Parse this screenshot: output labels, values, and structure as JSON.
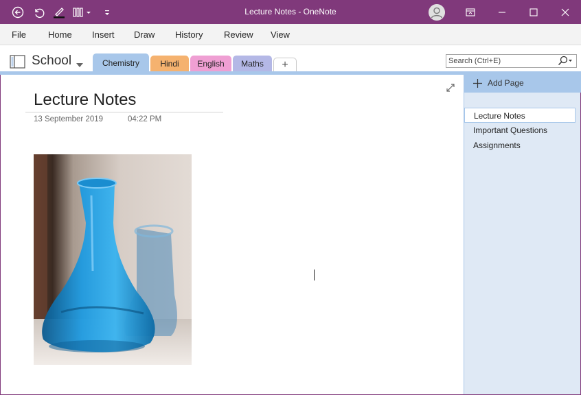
{
  "window": {
    "title": "Lecture Notes  -  OneNote",
    "accent_color": "#80397b",
    "qat_icons": [
      "back-icon",
      "undo-icon",
      "pen-icon",
      "touch-mode-icon",
      "customize-icon"
    ],
    "controls": [
      "ribbon-display-icon",
      "minimize-icon",
      "maximize-icon",
      "close-icon"
    ]
  },
  "menu": {
    "items": [
      "File",
      "Home",
      "Insert",
      "Draw",
      "History",
      "Review",
      "View"
    ]
  },
  "notebook": {
    "name": "School",
    "sections": [
      {
        "label": "Chemistry",
        "color": "#a8c7ea",
        "selected": true
      },
      {
        "label": "Hindi",
        "color": "#f5b26f",
        "selected": false
      },
      {
        "label": "English",
        "color": "#ef9fd3",
        "selected": false
      },
      {
        "label": "Maths",
        "color": "#b4b8e6",
        "selected": false
      }
    ],
    "add_section_label": "+"
  },
  "search": {
    "placeholder": "Search (Ctrl+E)"
  },
  "page": {
    "title": "Lecture Notes",
    "date": "13 September 2019",
    "time": "04:22 PM",
    "image_desc_icon": "conical-flask-photo"
  },
  "pages_panel": {
    "add_label": "Add Page",
    "items": [
      {
        "label": "Lecture Notes",
        "selected": true
      },
      {
        "label": "Important Questions",
        "selected": false
      },
      {
        "label": "Assignments",
        "selected": false
      }
    ]
  }
}
